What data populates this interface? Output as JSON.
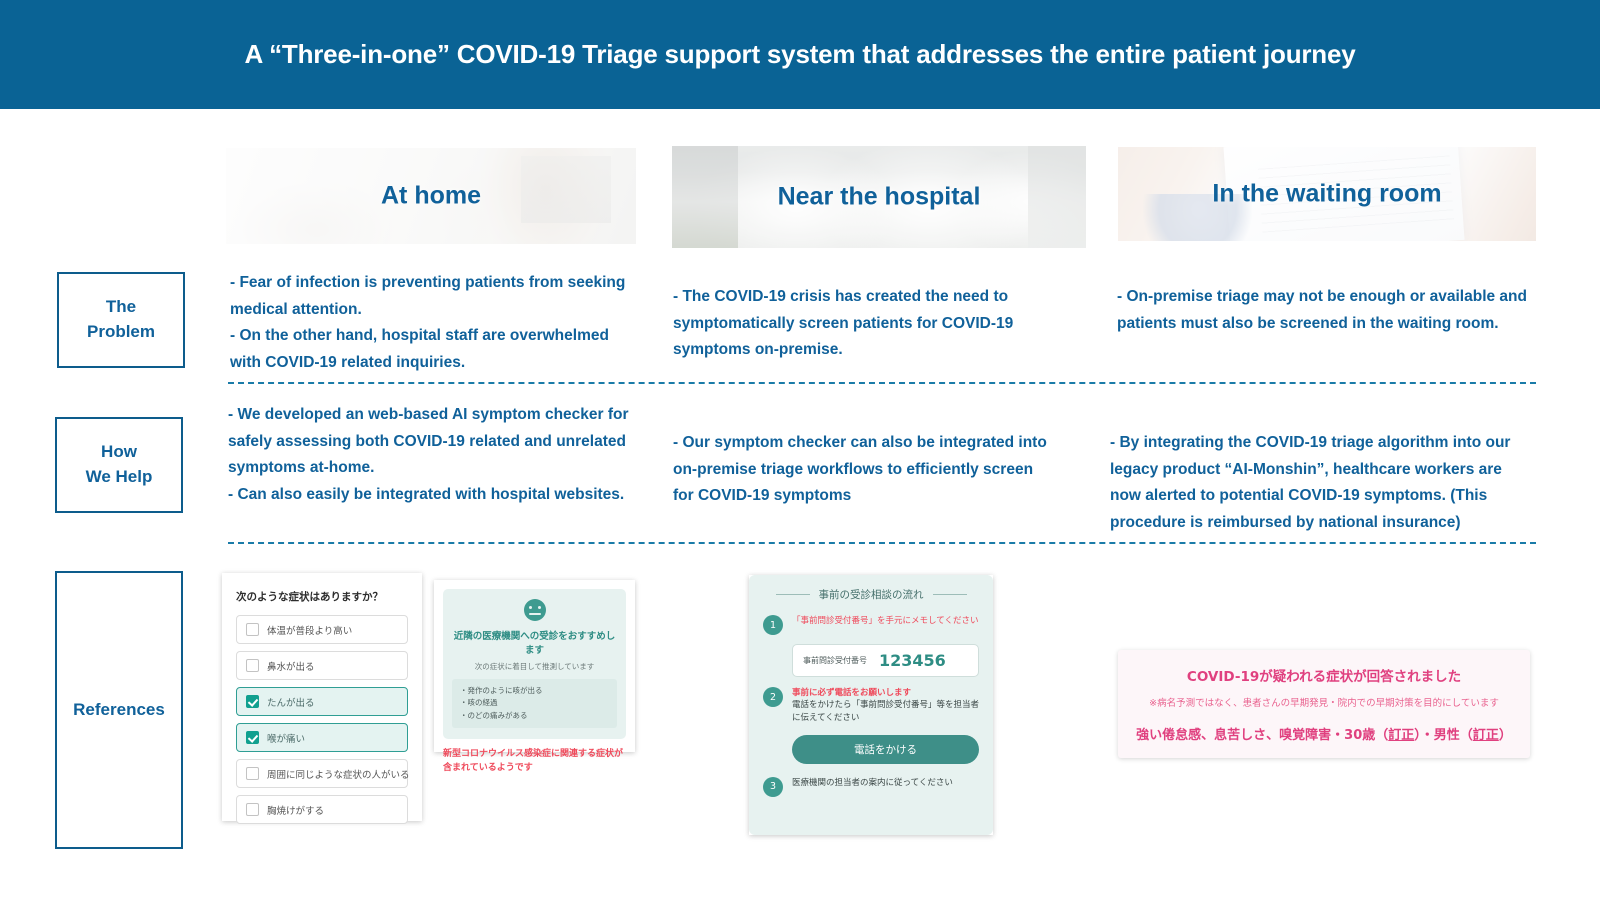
{
  "header": {
    "title": "A “Three-in-one” COVID-19 Triage support system that addresses the entire patient journey"
  },
  "columns": [
    {
      "banner_title": "At home"
    },
    {
      "banner_title": "Near the hospital"
    },
    {
      "banner_title": "In the waiting room"
    }
  ],
  "rows": {
    "problem": {
      "label_line1": "The",
      "label_line2": "Problem",
      "col1": "- Fear of infection is preventing patients from seeking medical attention.\n- On the other hand, hospital staff are overwhelmed with COVID-19 related inquiries.",
      "col2": "- The COVID-19 crisis has created the need to symptomatically screen patients for COVID-19 symptoms  on-premise.",
      "col3": "- On-premise triage may not be enough or available and patients must also be screened in the waiting room."
    },
    "help": {
      "label_line1": "How",
      "label_line2": "We Help",
      "col1": " - We developed an web-based AI symptom checker for safely assessing both COVID-19 related and unrelated symptoms at-home.\n- Can also easily be integrated with hospital websites.",
      "col2": " - Our symptom checker can also be integrated into on-premise triage workflows to efficiently screen for COVID-19 symptoms",
      "col3": "- By integrating  the COVID-19 triage algorithm into our legacy product “AI-Monshin”, healthcare workers are now alerted to potential COVID-19 symptoms. (This procedure is reimbursed by national insurance)"
    },
    "references": {
      "label": "References"
    }
  },
  "mockups": {
    "symptom_checker": {
      "question": "次のような症状はありますか？",
      "options": [
        {
          "label": "体温が普段より高い",
          "checked": false
        },
        {
          "label": "鼻水が出る",
          "checked": false
        },
        {
          "label": "たんが出る",
          "checked": true
        },
        {
          "label": "喉が痛い",
          "checked": true
        },
        {
          "label": "周囲に同じような症状の人がいる",
          "checked": false
        },
        {
          "label": "胸焼けがする",
          "checked": false
        }
      ]
    },
    "recommendation": {
      "face_icon": "neutral-face-icon",
      "heading": "近隣の医療機関への受診をおすすめします",
      "subheading": "次の症状に着目して推測しています",
      "symptoms": [
        "・発作のように咳が出る",
        "・咳の経過",
        "・のどの痛みがある"
      ],
      "warning": "新型コロナウイルス感染症に関連する症状が含まれているようです"
    },
    "flow": {
      "title": "事前の受診相談の流れ",
      "step1_num": "1",
      "step1_red": "「事前問診受付番号」を手元にメモしてください",
      "field_label": "事前問診受付番号",
      "field_value": "123456",
      "step2_num": "2",
      "step2_red": "事前に必ず電話をお願いします",
      "step2_black": "電話をかけたら「事前問診受付番号」等を担当者に伝えてください",
      "call_button": "電話をかける",
      "step3_num": "3",
      "step3_black": "医療機関の担当者の案内に従ってください"
    },
    "alert": {
      "line1": "COVID-19が疑われる症状が回答されました",
      "line2": "※病名予測ではなく、患者さんの早期発見・院内での早期対策を目的にしています",
      "line3_a": "強い倦怠感、息苦しさ、嗅覚障害・30歳（",
      "line3_link1": "訂正",
      "line3_b": "）・男性（",
      "line3_link2": "訂正",
      "line3_c": "）"
    }
  },
  "colors": {
    "header_bg": "#0a6395",
    "accent_blue": "#10619a",
    "divider": "#1a7ba8",
    "teal": "#3e9b90",
    "red": "#ef4b5c",
    "pink": "#e0407f"
  }
}
